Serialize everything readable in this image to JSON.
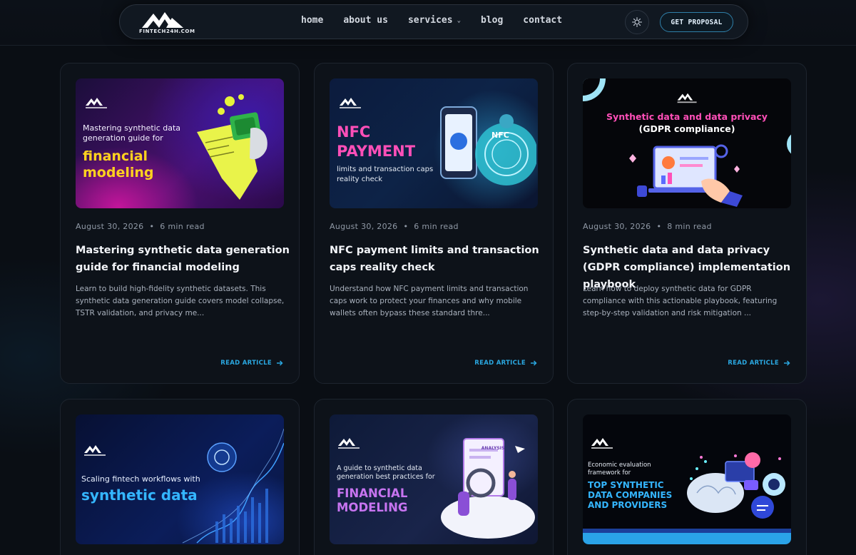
{
  "nav": {
    "logo_text": "FINTECH24H.COM",
    "links": [
      "home",
      "about us",
      "services",
      "blog",
      "contact"
    ],
    "cta": "GET PROPOSAL"
  },
  "cards": [
    {
      "thumb_small": "Mastering synthetic data generation guide for",
      "thumb_big": "financial modeling",
      "date": "August 30, 2026",
      "read_time": "6 min read",
      "title": "Mastering synthetic data generation guide for financial modeling",
      "excerpt": "Learn to build high-fidelity synthetic datasets. This synthetic data generation guide covers model collapse, TSTR validation, and privacy me...",
      "read_label": "READ ARTICLE"
    },
    {
      "thumb_big": "NFC PAYMENT",
      "thumb_small": "limits and transaction caps reality check",
      "thumb_tag": "NFC",
      "date": "August 30, 2026",
      "read_time": "6 min read",
      "title": "NFC payment limits and transaction caps reality check",
      "excerpt": "Understand how NFC payment limits and transaction caps work to protect your finances and why mobile wallets often bypass these standard thre...",
      "read_label": "READ ARTICLE"
    },
    {
      "thumb_big": "Synthetic data and data privacy",
      "thumb_small": "(GDPR compliance)",
      "date": "August 30, 2026",
      "read_time": "8 min read",
      "title": "Synthetic data and data privacy (GDPR compliance) implementation playbook",
      "excerpt": "Learn how to deploy synthetic data for GDPR compliance with this actionable playbook, featuring step-by-step validation and risk mitigation ...",
      "read_label": "READ ARTICLE"
    },
    {
      "thumb_small": "Scaling fintech workflows with",
      "thumb_big": "synthetic data"
    },
    {
      "thumb_small": "A guide to synthetic data generation best practices for",
      "thumb_big": "FINANCIAL MODELING",
      "thumb_tag": "ANALYSIS"
    },
    {
      "thumb_small": "Economic evaluation framework for",
      "thumb_big": "TOP SYNTHETIC DATA COMPANIES AND PROVIDERS"
    }
  ],
  "colors": {
    "accent": "#2aa7e0",
    "yellow": "#ffd21f",
    "pink": "#ff4fb8",
    "purple": "#c774f0",
    "cyan": "#34b6ff"
  }
}
